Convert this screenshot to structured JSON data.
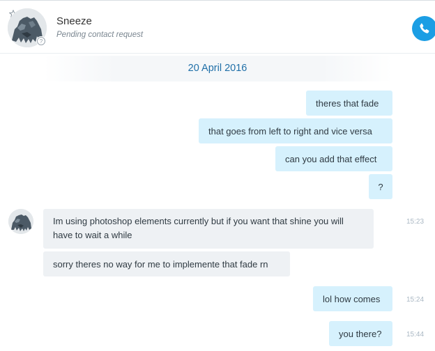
{
  "header": {
    "contact_name": "Sneeze",
    "contact_status": "Pending contact request",
    "icons": [
      "star-icon",
      "avatar",
      "pending-status-icon",
      "phone-icon"
    ]
  },
  "conversation": {
    "date": "20 April 2016",
    "messages": [
      {
        "dir": "out",
        "text": "theres that fade",
        "time": ""
      },
      {
        "dir": "out",
        "text": "that goes from left to right and vice versa",
        "time": ""
      },
      {
        "dir": "out",
        "text": "can you add that effect",
        "time": ""
      },
      {
        "dir": "out",
        "text": "?",
        "time": ""
      },
      {
        "dir": "in",
        "text": "Im using photoshop elements currently but if you want that shine you will have to wait a while",
        "time": "15:23"
      },
      {
        "dir": "in",
        "text": "sorry theres no way for me to implemente that fade rn",
        "time": ""
      },
      {
        "dir": "out",
        "text": "lol how comes",
        "time": "15:24"
      },
      {
        "dir": "out",
        "text": "you there?",
        "time": "15:44"
      }
    ]
  },
  "colors": {
    "accent": "#1b9ee4",
    "outgoing_bubble": "#d6f1fd",
    "incoming_bubble": "#eef1f4",
    "date_text": "#1f6fa8",
    "timestamp": "#a9b7c3"
  }
}
